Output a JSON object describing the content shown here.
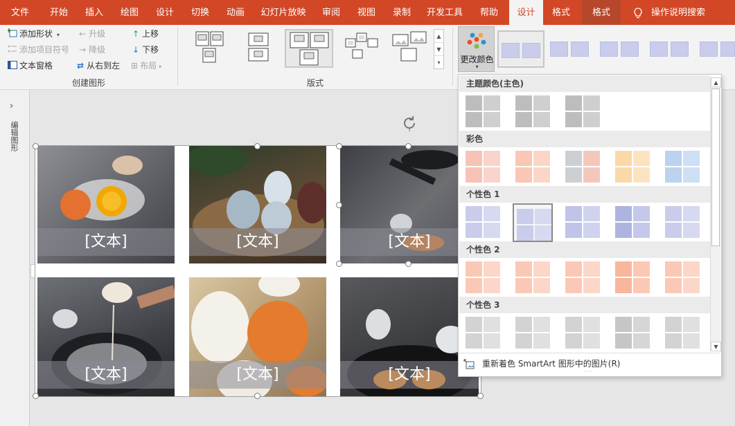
{
  "tabs": [
    {
      "label": "文件"
    },
    {
      "label": "开始"
    },
    {
      "label": "插入"
    },
    {
      "label": "绘图"
    },
    {
      "label": "设计"
    },
    {
      "label": "切换"
    },
    {
      "label": "动画"
    },
    {
      "label": "幻灯片放映"
    },
    {
      "label": "审阅"
    },
    {
      "label": "视图"
    },
    {
      "label": "录制"
    },
    {
      "label": "开发工具"
    },
    {
      "label": "帮助"
    },
    {
      "label": "设计"
    },
    {
      "label": "格式"
    },
    {
      "label": "格式"
    },
    {
      "label": "操作说明搜索"
    }
  ],
  "ribbon": {
    "create_group": {
      "label": "创建图形",
      "add_shape": "添加形状",
      "add_bullet": "添加项目符号",
      "text_pane": "文本窗格",
      "promote": "升级",
      "demote": "降级",
      "rtl": "从右到左",
      "move_up": "上移",
      "move_down": "下移",
      "layout": "布局"
    },
    "layouts_group": {
      "label": "版式"
    },
    "change_colors": "更改颜色"
  },
  "side_panel": {
    "label": "编辑图形"
  },
  "slide": {
    "placeholders": [
      "[文本]",
      "[文本]",
      "[文本]",
      "[文本]",
      "[文本]",
      "[文本]"
    ]
  },
  "colors_dropdown": {
    "sections": [
      {
        "title": "主题颜色(主色)"
      },
      {
        "title": "彩色"
      },
      {
        "title": "个性色 1"
      },
      {
        "title": "个性色 2"
      },
      {
        "title": "个性色 3"
      }
    ],
    "footer": "重新着色 SmartArt 图形中的图片(R)"
  },
  "colors": {
    "accent": "#d24726",
    "context_tab": "#b7472a",
    "lavender": "#c9cdeb"
  }
}
